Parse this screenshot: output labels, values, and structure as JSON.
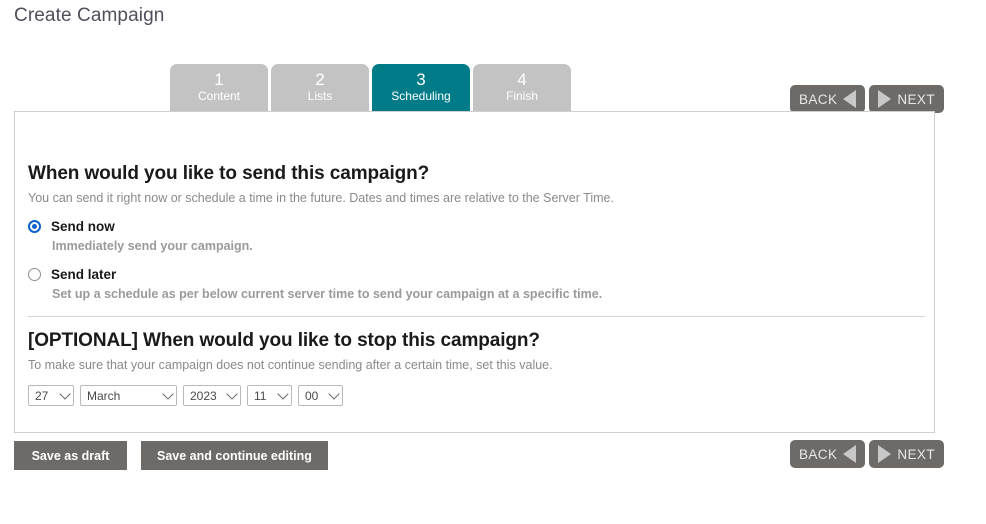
{
  "page": {
    "title": "Create Campaign"
  },
  "steps": [
    {
      "number": "1",
      "label": "Content",
      "active": false
    },
    {
      "number": "2",
      "label": "Lists",
      "active": false
    },
    {
      "number": "3",
      "label": "Scheduling",
      "active": true
    },
    {
      "number": "4",
      "label": "Finish",
      "active": false
    }
  ],
  "nav": {
    "back_label": "BACK",
    "next_label": "NEXT"
  },
  "send_section": {
    "title": "When would you like to send this campaign?",
    "subtitle": "You can send it right now or schedule a time in the future. Dates and times are relative to the Server Time.",
    "options": [
      {
        "label": "Send now",
        "help": "Immediately send your campaign.",
        "selected": true
      },
      {
        "label": "Send later",
        "help": "Set up a schedule as per below current server time to send your campaign at a specific time.",
        "selected": false
      }
    ]
  },
  "stop_section": {
    "title": "[OPTIONAL] When would you like to stop this campaign?",
    "subtitle": "To make sure that your campaign does not continue sending after a certain time, set this value.",
    "selects": [
      {
        "name": "day",
        "value": "27"
      },
      {
        "name": "month",
        "value": "March"
      },
      {
        "name": "year",
        "value": "2023"
      },
      {
        "name": "hour",
        "value": "11"
      },
      {
        "name": "minute",
        "value": "00"
      }
    ]
  },
  "footer": {
    "save_draft_label": "Save as draft",
    "save_continue_label": "Save and continue editing"
  },
  "colors": {
    "accent_teal": "#007b87",
    "tab_inactive": "#c3c3c3",
    "button_gray": "#6d6a67",
    "radio_blue": "#0a62d0",
    "title_gray": "#50505c"
  }
}
